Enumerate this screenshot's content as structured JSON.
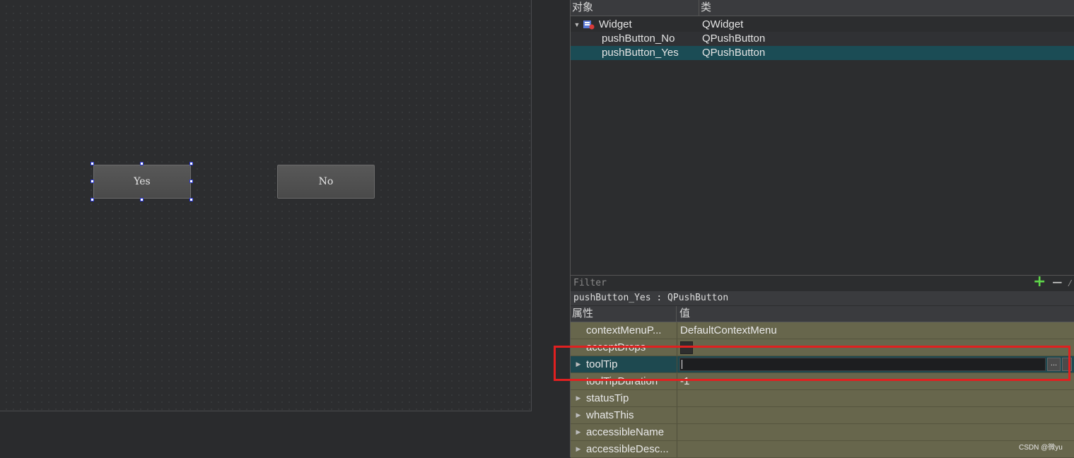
{
  "canvas": {
    "yes_label": "Yes",
    "no_label": "No"
  },
  "object_inspector": {
    "col_object": "对象",
    "col_class": "类",
    "rows": [
      {
        "name": "Widget",
        "class": "QWidget"
      },
      {
        "name": "pushButton_No",
        "class": "QPushButton"
      },
      {
        "name": "pushButton_Yes",
        "class": "QPushButton"
      }
    ]
  },
  "property_editor": {
    "filter_placeholder": "Filter",
    "add_icon": "+",
    "remove_icon": "−",
    "class_line": "pushButton_Yes : QPushButton",
    "col_property": "属性",
    "col_value": "值",
    "props": [
      {
        "name": "contextMenuP...",
        "value": "DefaultContextMenu"
      },
      {
        "name": "acceptDrops",
        "value": ""
      },
      {
        "name": "toolTip",
        "value": "",
        "browse": "..."
      },
      {
        "name": "toolTipDuration",
        "value": "-1"
      },
      {
        "name": "statusTip",
        "value": ""
      },
      {
        "name": "whatsThis",
        "value": ""
      },
      {
        "name": "accessibleName",
        "value": ""
      },
      {
        "name": "accessibleDesc...",
        "value": ""
      }
    ]
  },
  "watermark": "CSDN @微yu",
  "colors": {
    "selection_teal": "#1b4c55",
    "property_olive": "#67664c",
    "highlight_red": "#e02020",
    "handle_blue": "#2d3bd8"
  }
}
